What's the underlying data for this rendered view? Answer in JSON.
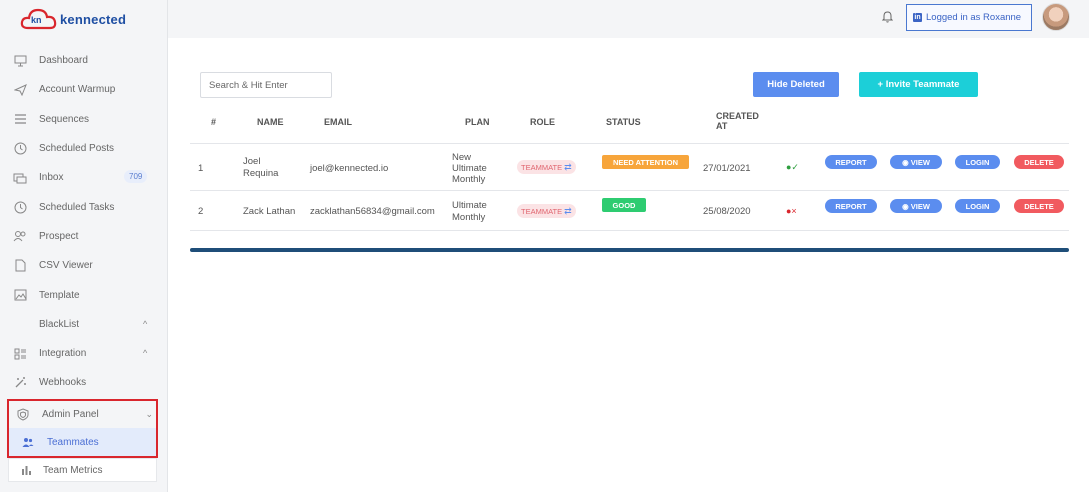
{
  "brand": {
    "name": "kennected",
    "mark": "kn"
  },
  "sidebar": {
    "items": [
      {
        "label": "Dashboard"
      },
      {
        "label": "Account Warmup"
      },
      {
        "label": "Sequences"
      },
      {
        "label": "Scheduled Posts"
      },
      {
        "label": "Inbox",
        "badge": "709"
      },
      {
        "label": "Scheduled Tasks"
      },
      {
        "label": "Prospect"
      },
      {
        "label": "CSV Viewer"
      },
      {
        "label": "Template"
      },
      {
        "label": "BlackList"
      },
      {
        "label": "Integration"
      },
      {
        "label": "Webhooks"
      }
    ],
    "admin_panel": "Admin Panel",
    "teammates": "Teammates",
    "team_metrics": "Team Metrics"
  },
  "header": {
    "logged_in": "Logged in as Roxanne"
  },
  "main": {
    "search_placeholder": "Search & Hit Enter",
    "hide_deleted": "Hide Deleted",
    "invite": "+ Invite Teammate",
    "columns": [
      "#",
      "NAME",
      "EMAIL",
      "PLAN",
      "ROLE",
      "STATUS",
      "CREATED",
      "AT"
    ],
    "rows": [
      {
        "num": "1",
        "name": [
          "Joel",
          "Requina"
        ],
        "email": "joel@kennected.io",
        "plan": [
          "New",
          "Ultimate",
          "Monthly"
        ],
        "role": "TEAMMATE",
        "status": "NEED ATTENTION",
        "created": "27/01/2021",
        "active": true
      },
      {
        "num": "2",
        "name": [
          "Zack Lathan"
        ],
        "email": "zacklathan56834@gmail.com",
        "plan": [
          "Ultimate",
          "Monthly"
        ],
        "role": "TEAMMATE",
        "status": "GOOD",
        "created": "25/08/2020",
        "active": false
      }
    ],
    "actions": {
      "report": "REPORT",
      "view": "VIEW",
      "login": "LOGIN",
      "delete": "DELETE"
    }
  },
  "colors": {
    "primary": "#5b8def",
    "accent": "#1ccfd8",
    "danger": "#f15a5f",
    "warning": "#f7a53b",
    "success": "#2ecc71"
  }
}
